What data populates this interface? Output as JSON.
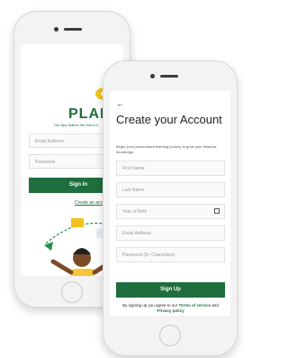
{
  "signin_screen": {
    "brand": "PLAN-I",
    "tagline": "Our App Makes the World C",
    "email_placeholder": "Email Address",
    "password_placeholder": "Password",
    "signin_label": "Sign In",
    "create_account_link": "Create an accou"
  },
  "signup_screen": {
    "title": "Create your Account",
    "subtitle": "Begin your personalized learning journey to grow your financial knowledge.",
    "fields": {
      "first_name": "First Name",
      "last_name": "Last Name",
      "year_of_birth": "Year of Birth",
      "email": "Email Address",
      "password": "Password (8+ Characters)"
    },
    "signup_label": "Sign Up",
    "terms_prefix": "By signing up you agree to our",
    "terms_link": "Terms of service",
    "terms_and": "and",
    "privacy_link": "Privacy policy"
  },
  "colors": {
    "brand_green": "#1f6e3d",
    "accent_yellow": "#f2c21b"
  },
  "icons": [
    "back-arrow-icon",
    "calendar-icon",
    "logo-icon"
  ]
}
